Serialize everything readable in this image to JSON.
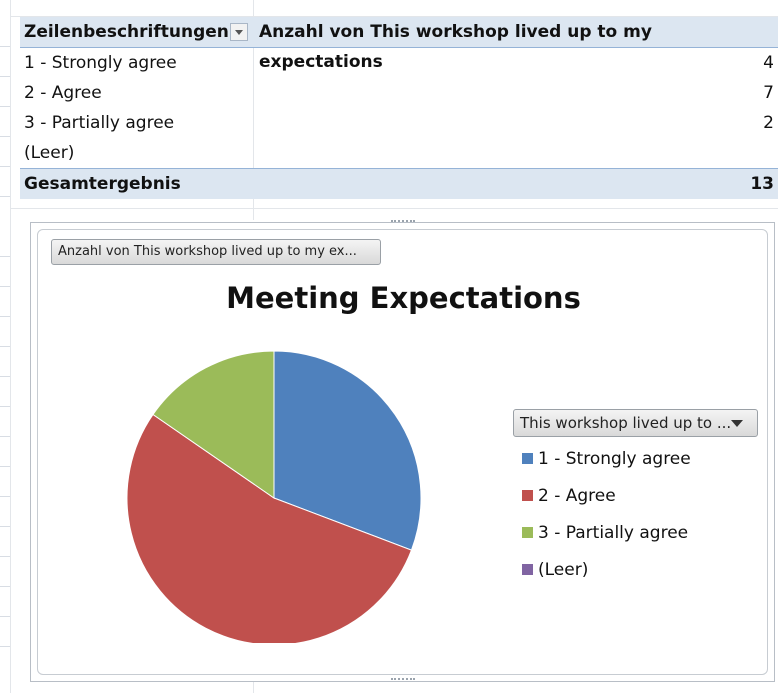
{
  "pivot": {
    "row_header": "Zeilenbeschriftungen",
    "value_header": "Anzahl von This workshop lived up to my expectations",
    "rows": [
      {
        "label": "1 - Strongly agree",
        "value": "4"
      },
      {
        "label": "2 - Agree",
        "value": "7"
      },
      {
        "label": "3 - Partially agree",
        "value": "2"
      },
      {
        "label": "(Leer)",
        "value": ""
      }
    ],
    "total_label": "Gesamtergebnis",
    "total_value": "13"
  },
  "chart": {
    "field_button": "Anzahl von This workshop lived up to my ex...",
    "legend_button": "This workshop lived up to ...",
    "title": "Meeting Expectations"
  },
  "chart_data": {
    "type": "pie",
    "title": "Meeting Expectations",
    "categories": [
      "1 - Strongly agree",
      "2 - Agree",
      "3 - Partially agree",
      "(Leer)"
    ],
    "values": [
      4,
      7,
      2,
      0
    ],
    "colors": [
      "#4f81bd",
      "#c0504d",
      "#9bbb59",
      "#8064a2"
    ],
    "legend_placement": "right"
  },
  "icons": {
    "filter_dropdown": "chevron-down-icon",
    "legend_dropdown": "chevron-down-icon"
  }
}
